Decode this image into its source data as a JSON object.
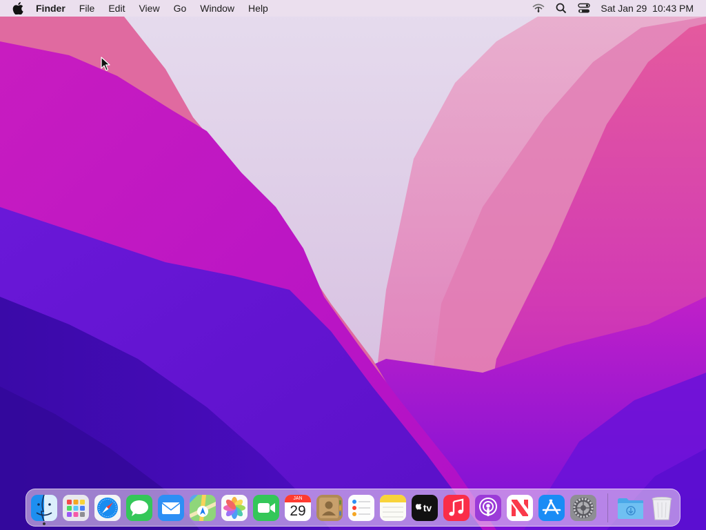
{
  "menubar": {
    "apple_icon": "apple-icon",
    "app_name": "Finder",
    "menus": [
      "File",
      "Edit",
      "View",
      "Go",
      "Window",
      "Help"
    ],
    "status_icons": [
      "wifi-icon",
      "search-icon",
      "control-center-icon"
    ],
    "clock": "Sat Jan 29  10:43 PM"
  },
  "dock": {
    "apps": [
      {
        "name": "Finder",
        "icon": "finder-icon",
        "running": true
      },
      {
        "name": "Launchpad",
        "icon": "launchpad-icon"
      },
      {
        "name": "Safari",
        "icon": "safari-icon"
      },
      {
        "name": "Messages",
        "icon": "messages-icon"
      },
      {
        "name": "Mail",
        "icon": "mail-icon"
      },
      {
        "name": "Maps",
        "icon": "maps-icon"
      },
      {
        "name": "Photos",
        "icon": "photos-icon"
      },
      {
        "name": "FaceTime",
        "icon": "facetime-icon"
      },
      {
        "name": "Calendar",
        "icon": "calendar-icon",
        "month": "JAN",
        "day": "29"
      },
      {
        "name": "Contacts",
        "icon": "contacts-icon"
      },
      {
        "name": "Reminders",
        "icon": "reminders-icon"
      },
      {
        "name": "Notes",
        "icon": "notes-icon"
      },
      {
        "name": "TV",
        "icon": "tv-icon",
        "label": "tv"
      },
      {
        "name": "Music",
        "icon": "music-icon"
      },
      {
        "name": "Podcasts",
        "icon": "podcasts-icon"
      },
      {
        "name": "News",
        "icon": "news-icon"
      },
      {
        "name": "App Store",
        "icon": "app-store-icon"
      },
      {
        "name": "System Preferences",
        "icon": "system-preferences-icon"
      }
    ],
    "others": [
      {
        "name": "Downloads",
        "icon": "downloads-folder-icon"
      },
      {
        "name": "Trash",
        "icon": "trash-icon"
      }
    ]
  },
  "colors": {
    "wallpaper_magenta": "#c014c0",
    "wallpaper_purple": "#5a0fd0",
    "wallpaper_pink": "#e0609a",
    "wallpaper_haze": "#d8c8e8"
  }
}
